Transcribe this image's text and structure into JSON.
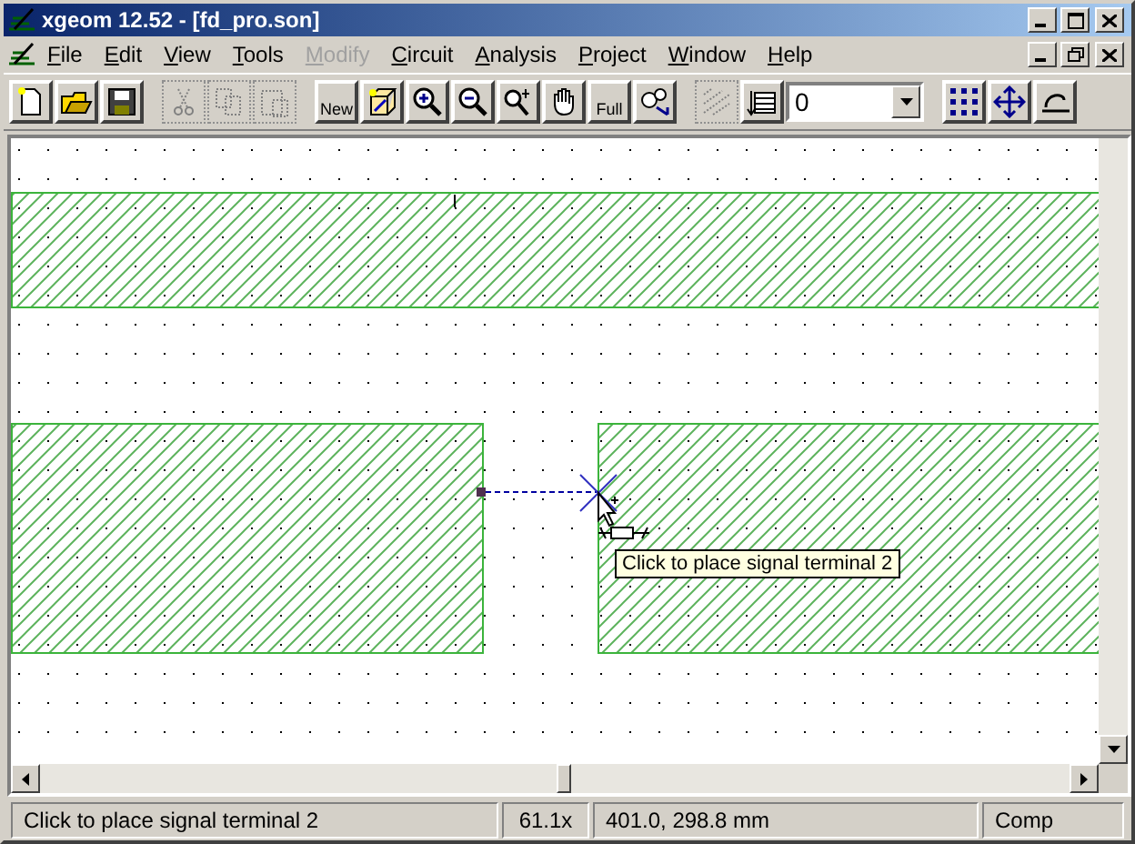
{
  "window": {
    "title": "xgeom 12.52 - [fd_pro.son]"
  },
  "menu": [
    {
      "label": "File",
      "disabled": false
    },
    {
      "label": "Edit",
      "disabled": false
    },
    {
      "label": "View",
      "disabled": false
    },
    {
      "label": "Tools",
      "disabled": false
    },
    {
      "label": "Modify",
      "disabled": true
    },
    {
      "label": "Circuit",
      "disabled": false
    },
    {
      "label": "Analysis",
      "disabled": false
    },
    {
      "label": "Project",
      "disabled": false
    },
    {
      "label": "Window",
      "disabled": false
    },
    {
      "label": "Help",
      "disabled": false
    }
  ],
  "toolbar": [
    {
      "kind": "new-file",
      "disabled": false
    },
    {
      "kind": "open",
      "disabled": false
    },
    {
      "kind": "save",
      "disabled": false
    },
    {
      "kind": "sep"
    },
    {
      "kind": "cut",
      "disabled": true
    },
    {
      "kind": "copy",
      "disabled": true
    },
    {
      "kind": "paste",
      "disabled": true
    },
    {
      "kind": "sep"
    },
    {
      "kind": "text",
      "label": "New",
      "disabled": false
    },
    {
      "kind": "box3d",
      "disabled": false
    },
    {
      "kind": "zoom-in",
      "disabled": false
    },
    {
      "kind": "zoom-out",
      "disabled": false
    },
    {
      "kind": "zoom-area",
      "disabled": false
    },
    {
      "kind": "hand",
      "disabled": false
    },
    {
      "kind": "text",
      "label": "Full",
      "disabled": false
    },
    {
      "kind": "zoom-fit",
      "disabled": false
    },
    {
      "kind": "sep"
    },
    {
      "kind": "hatch",
      "disabled": true
    },
    {
      "kind": "layers",
      "disabled": false
    },
    {
      "kind": "combo",
      "value": "0"
    },
    {
      "kind": "sep"
    },
    {
      "kind": "grid",
      "disabled": false
    },
    {
      "kind": "move",
      "disabled": false
    },
    {
      "kind": "partial",
      "disabled": false
    }
  ],
  "tooltip": "Click to place signal terminal 2",
  "status_bar": [
    "Click to place signal terminal 2",
    "61.1x",
    "401.0, 298.8 mm",
    "Comp"
  ]
}
